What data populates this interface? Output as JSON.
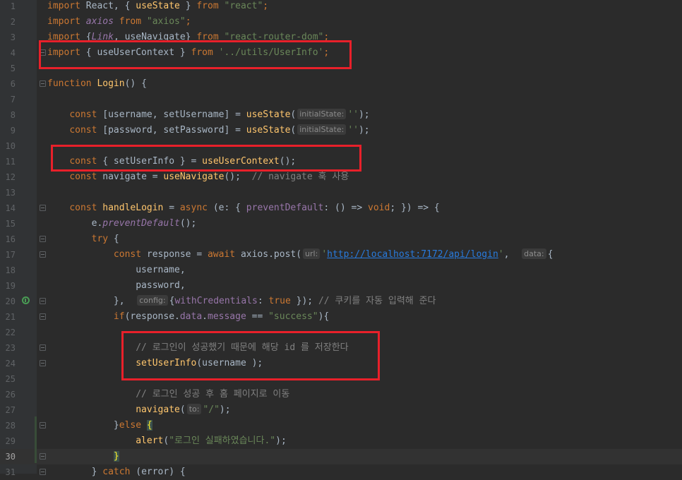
{
  "editor": {
    "current_line": 30,
    "lines": [
      {
        "n": "1",
        "tokens": [
          {
            "t": "import",
            "c": "kw"
          },
          {
            "t": " React, { "
          },
          {
            "t": "useState",
            "c": "fn"
          },
          {
            "t": " } "
          },
          {
            "t": "from",
            "c": "kw"
          },
          {
            "t": " "
          },
          {
            "t": "\"react\"",
            "c": "str"
          },
          {
            "t": ";",
            "c": "kw"
          }
        ]
      },
      {
        "n": "2",
        "tokens": [
          {
            "t": "import",
            "c": "kw"
          },
          {
            "t": " "
          },
          {
            "t": "axios",
            "c": "prop it"
          },
          {
            "t": " "
          },
          {
            "t": "from",
            "c": "kw"
          },
          {
            "t": " "
          },
          {
            "t": "\"axios\"",
            "c": "str"
          },
          {
            "t": ";",
            "c": "kw"
          }
        ]
      },
      {
        "n": "3",
        "tokens": [
          {
            "t": "import",
            "c": "kw"
          },
          {
            "t": " {"
          },
          {
            "t": "Link",
            "c": "prop it"
          },
          {
            "t": ", useNavigate} "
          },
          {
            "t": "from",
            "c": "kw"
          },
          {
            "t": " "
          },
          {
            "t": "\"react-router-dom\"",
            "c": "str"
          },
          {
            "t": ";",
            "c": "kw"
          }
        ]
      },
      {
        "n": "4",
        "tokens": [
          {
            "t": "import",
            "c": "kw"
          },
          {
            "t": " { useUserContext } "
          },
          {
            "t": "from",
            "c": "kw"
          },
          {
            "t": " "
          },
          {
            "t": "'../utils/UserInfo'",
            "c": "str"
          },
          {
            "t": ";",
            "c": "kw"
          }
        ]
      },
      {
        "n": "5",
        "tokens": []
      },
      {
        "n": "6",
        "tokens": [
          {
            "t": "function",
            "c": "kw"
          },
          {
            "t": " "
          },
          {
            "t": "Login",
            "c": "fn"
          },
          {
            "t": "() {"
          }
        ]
      },
      {
        "n": "7",
        "tokens": []
      },
      {
        "n": "8",
        "tokens": [
          {
            "t": "    "
          },
          {
            "t": "const",
            "c": "kw"
          },
          {
            "t": " [username, setUsername] = "
          },
          {
            "t": "useState",
            "c": "fn"
          },
          {
            "t": "("
          },
          {
            "h": "initialState:"
          },
          {
            "t": "''",
            "c": "str"
          },
          {
            "t": ");"
          }
        ]
      },
      {
        "n": "9",
        "tokens": [
          {
            "t": "    "
          },
          {
            "t": "const",
            "c": "kw"
          },
          {
            "t": " [password, setPassword] = "
          },
          {
            "t": "useState",
            "c": "fn"
          },
          {
            "t": "("
          },
          {
            "h": "initialState:"
          },
          {
            "t": "''",
            "c": "str"
          },
          {
            "t": ");"
          }
        ]
      },
      {
        "n": "10",
        "tokens": []
      },
      {
        "n": "11",
        "tokens": [
          {
            "t": "    "
          },
          {
            "t": "const",
            "c": "kw"
          },
          {
            "t": " { setUserInfo } = "
          },
          {
            "t": "useUserContext",
            "c": "fn"
          },
          {
            "t": "();"
          }
        ]
      },
      {
        "n": "12",
        "tokens": [
          {
            "t": "    "
          },
          {
            "t": "const",
            "c": "kw"
          },
          {
            "t": " navigate = "
          },
          {
            "t": "useNavigate",
            "c": "fn"
          },
          {
            "t": "();  "
          },
          {
            "t": "// navigate 훅 사용",
            "c": "cmt"
          }
        ]
      },
      {
        "n": "13",
        "tokens": []
      },
      {
        "n": "14",
        "tokens": [
          {
            "t": "    "
          },
          {
            "t": "const",
            "c": "kw"
          },
          {
            "t": " "
          },
          {
            "t": "handleLogin",
            "c": "fn"
          },
          {
            "t": " = "
          },
          {
            "t": "async",
            "c": "kw"
          },
          {
            "t": " (e: { "
          },
          {
            "t": "preventDefault",
            "c": "prop"
          },
          {
            "t": ": () => "
          },
          {
            "t": "void",
            "c": "kw"
          },
          {
            "t": "; }) => {"
          }
        ]
      },
      {
        "n": "15",
        "tokens": [
          {
            "t": "        e."
          },
          {
            "t": "preventDefault",
            "c": "prop it"
          },
          {
            "t": "();"
          }
        ]
      },
      {
        "n": "16",
        "tokens": [
          {
            "t": "        "
          },
          {
            "t": "try",
            "c": "kw"
          },
          {
            "t": " {"
          }
        ]
      },
      {
        "n": "17",
        "tokens": [
          {
            "t": "            "
          },
          {
            "t": "const",
            "c": "kw"
          },
          {
            "t": " response = "
          },
          {
            "t": "await",
            "c": "kw"
          },
          {
            "t": " axios.post("
          },
          {
            "h": "url:"
          },
          {
            "t": "'",
            "c": "str"
          },
          {
            "t": "http://localhost:7172/api/login",
            "c": "str url"
          },
          {
            "t": "'",
            "c": "str"
          },
          {
            "t": ",  "
          },
          {
            "h": "data:"
          },
          {
            "t": "{"
          }
        ]
      },
      {
        "n": "18",
        "tokens": [
          {
            "t": "                username,"
          }
        ]
      },
      {
        "n": "19",
        "tokens": [
          {
            "t": "                password,"
          }
        ]
      },
      {
        "n": "20",
        "tokens": [
          {
            "t": "            },  "
          },
          {
            "h": "config:"
          },
          {
            "t": "{"
          },
          {
            "t": "withCredentials",
            "c": "prop"
          },
          {
            "t": ": "
          },
          {
            "t": "true",
            "c": "kw"
          },
          {
            "t": " }); "
          },
          {
            "t": "// 쿠키를 자동 입력해 준다",
            "c": "cmt"
          }
        ]
      },
      {
        "n": "21",
        "tokens": [
          {
            "t": "            "
          },
          {
            "t": "if",
            "c": "kw"
          },
          {
            "t": "(response."
          },
          {
            "t": "data",
            "c": "prop"
          },
          {
            "t": "."
          },
          {
            "t": "message",
            "c": "prop"
          },
          {
            "t": " == "
          },
          {
            "t": "\"success\"",
            "c": "str"
          },
          {
            "t": "){"
          }
        ]
      },
      {
        "n": "22",
        "tokens": []
      },
      {
        "n": "23",
        "tokens": [
          {
            "t": "                "
          },
          {
            "t": "// 로그인이 성공했기 때문에 해당 id 를 저장한다",
            "c": "cmt"
          }
        ]
      },
      {
        "n": "24",
        "tokens": [
          {
            "t": "                "
          },
          {
            "t": "setUserInfo",
            "c": "fn"
          },
          {
            "t": "(username );"
          }
        ]
      },
      {
        "n": "25",
        "tokens": []
      },
      {
        "n": "26",
        "tokens": [
          {
            "t": "                "
          },
          {
            "t": "// 로그인 성공 후 홈 페이지로 이동",
            "c": "cmt"
          }
        ]
      },
      {
        "n": "27",
        "tokens": [
          {
            "t": "                "
          },
          {
            "t": "navigate",
            "c": "fn"
          },
          {
            "t": "("
          },
          {
            "h": "to:"
          },
          {
            "t": "\"/\"",
            "c": "str"
          },
          {
            "t": ");"
          }
        ]
      },
      {
        "n": "28",
        "tokens": [
          {
            "t": "            }"
          },
          {
            "t": "else",
            "c": "kw"
          },
          {
            "t": " "
          },
          {
            "t": "{",
            "c": "brace-hl"
          }
        ]
      },
      {
        "n": "29",
        "tokens": [
          {
            "t": "                "
          },
          {
            "t": "alert",
            "c": "fn"
          },
          {
            "t": "("
          },
          {
            "t": "\"로그인 실패하였습니다.\"",
            "c": "str"
          },
          {
            "t": ");"
          }
        ]
      },
      {
        "n": "30",
        "tokens": [
          {
            "t": "            "
          },
          {
            "t": "}",
            "c": "brace-hl"
          }
        ]
      },
      {
        "n": "31",
        "tokens": [
          {
            "t": "        } "
          },
          {
            "t": "catch",
            "c": "kw"
          },
          {
            "t": " (error) {"
          }
        ]
      }
    ]
  }
}
